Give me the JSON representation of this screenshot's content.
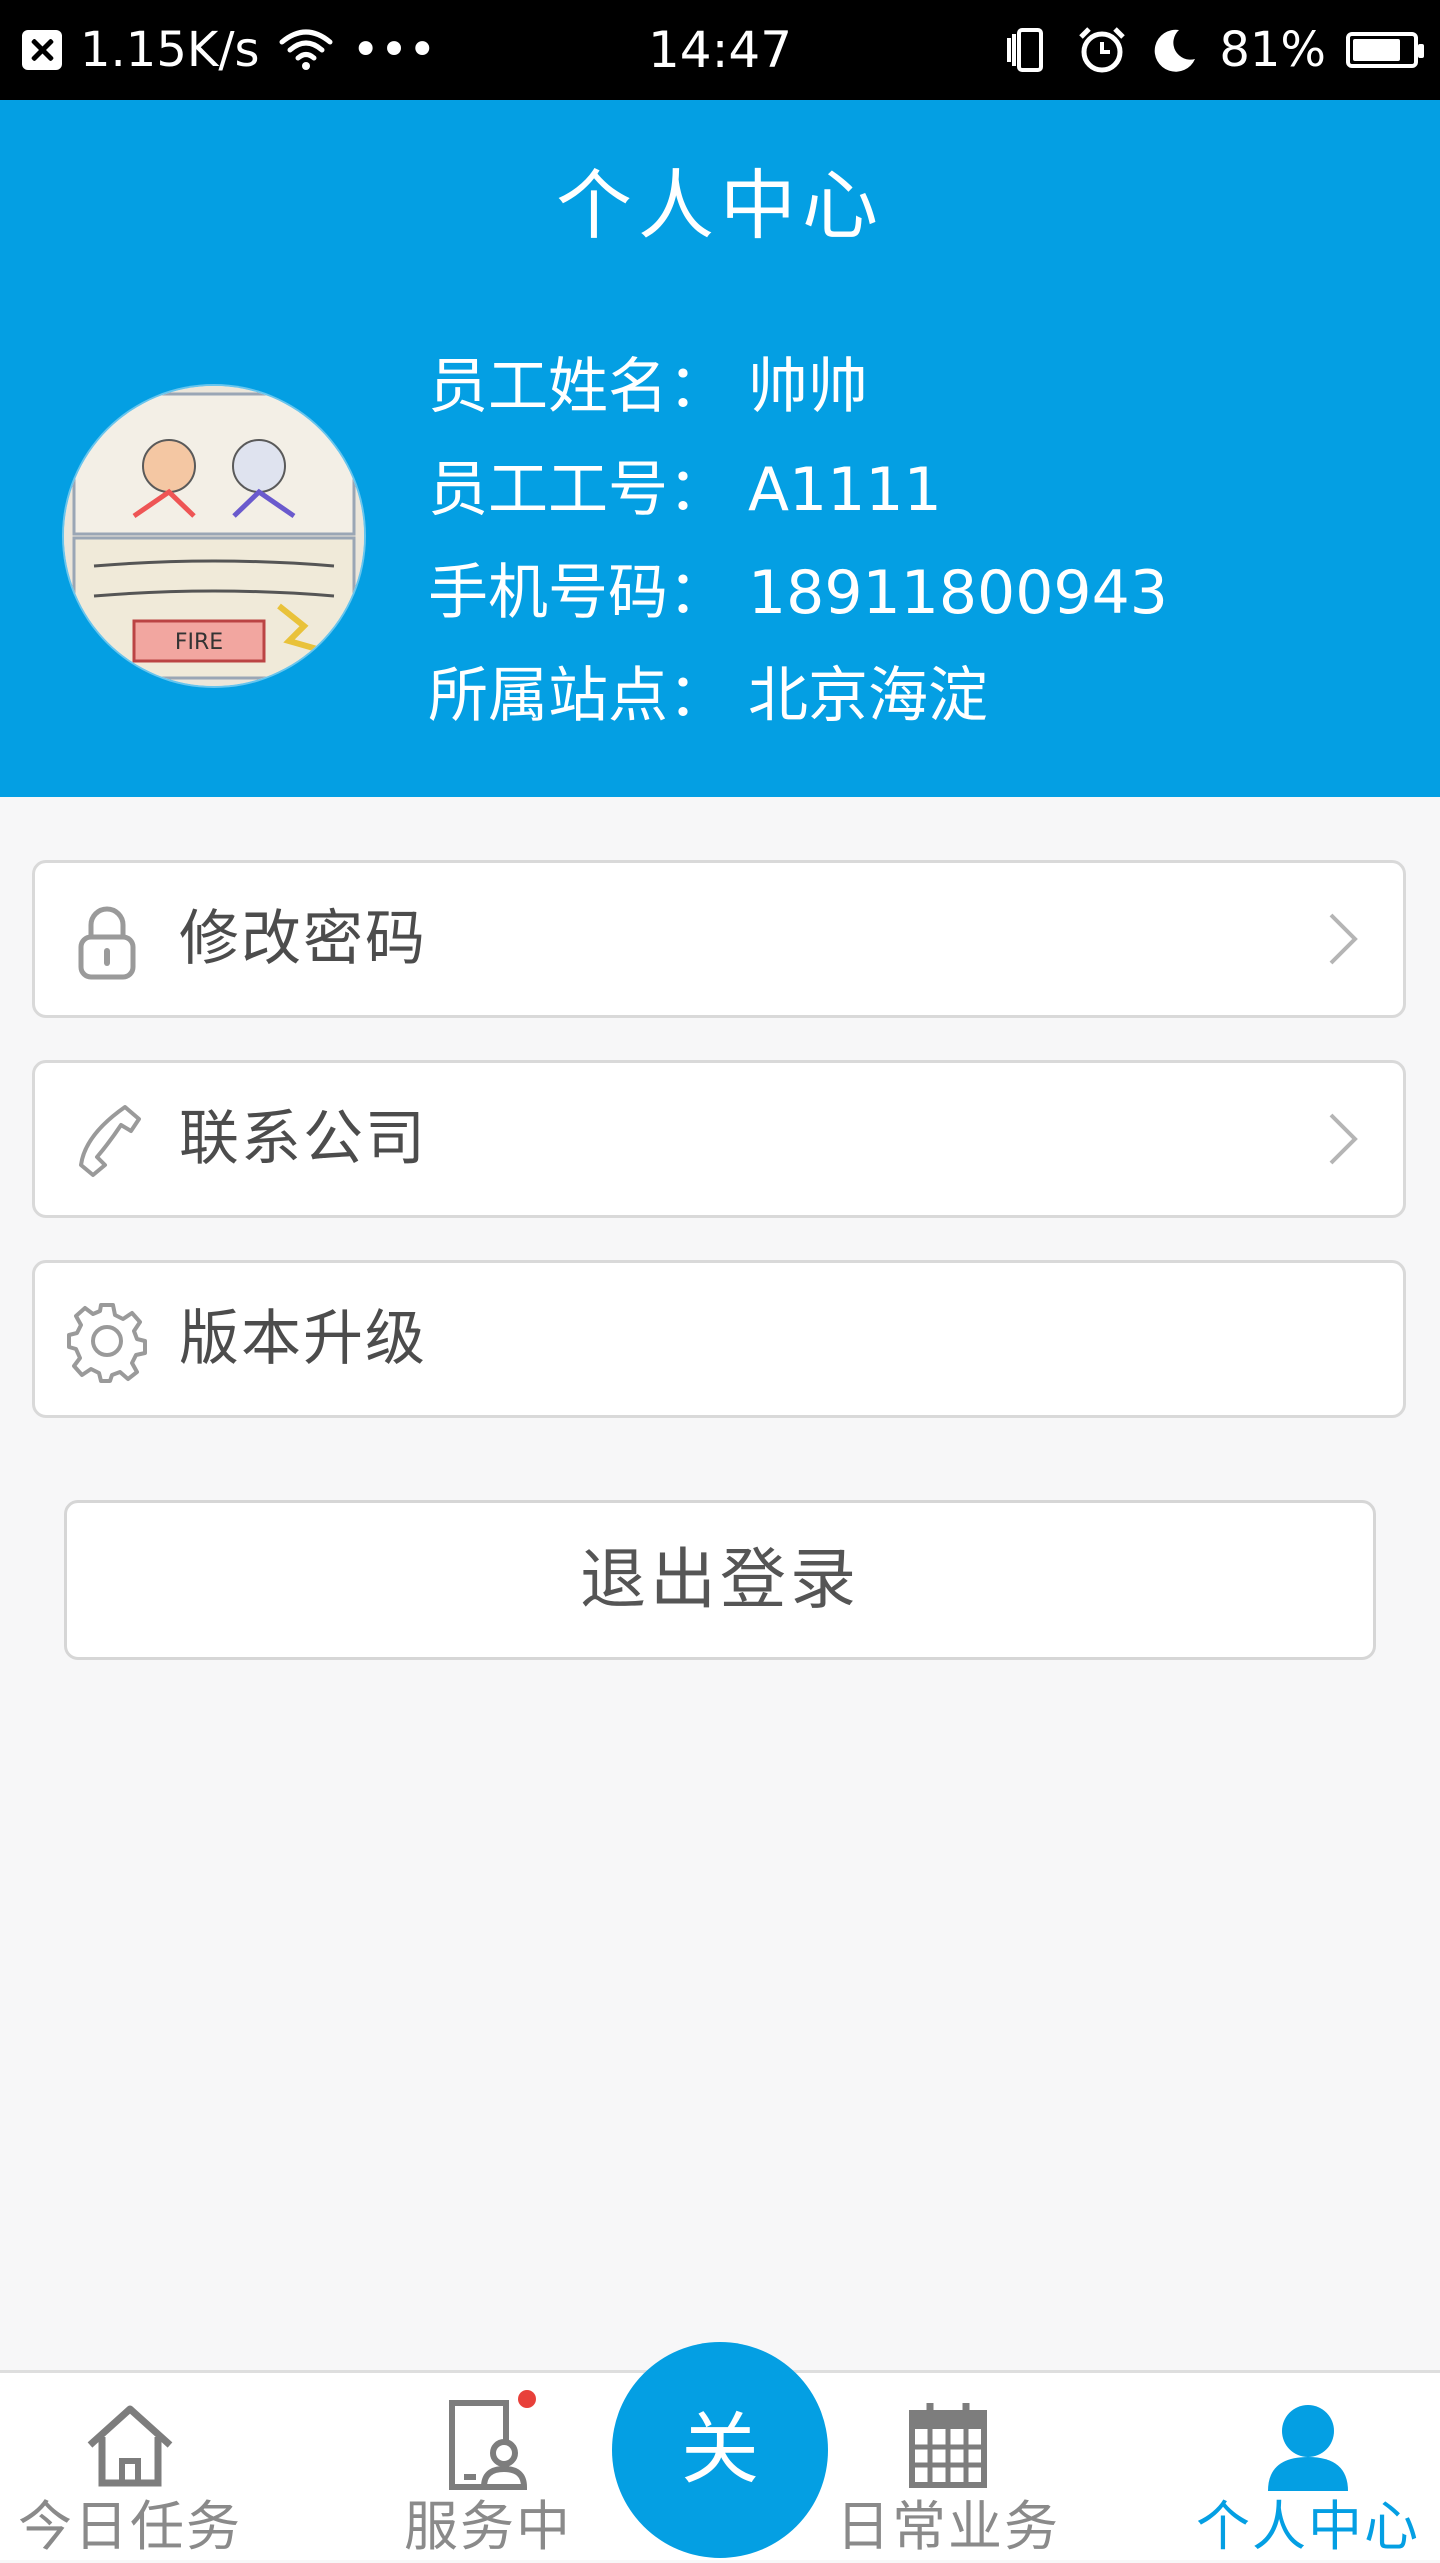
{
  "status_bar": {
    "net_speed": "1.15K/s",
    "more": "•••",
    "time": "14:47",
    "battery": "81%",
    "battery_level": 0.81
  },
  "header": {
    "title": "个人中心",
    "info": [
      {
        "label": "员工姓名：",
        "value": "帅帅"
      },
      {
        "label": "员工工号：",
        "value": "A1111"
      },
      {
        "label": "手机号码：",
        "value": "18911800943"
      },
      {
        "label": "所属站点：",
        "value": "北京海淀"
      }
    ]
  },
  "menu": {
    "change_password": "修改密码",
    "contact_company": "联系公司",
    "version_upgrade": "版本升级"
  },
  "logout_label": "退出登录",
  "bottom_nav": {
    "today_tasks": "今日任务",
    "in_service": "服务中",
    "center": "关",
    "daily_business": "日常业务",
    "personal_center": "个人中心"
  },
  "colors": {
    "accent": "#049fe3",
    "badge": "#e8403a"
  }
}
